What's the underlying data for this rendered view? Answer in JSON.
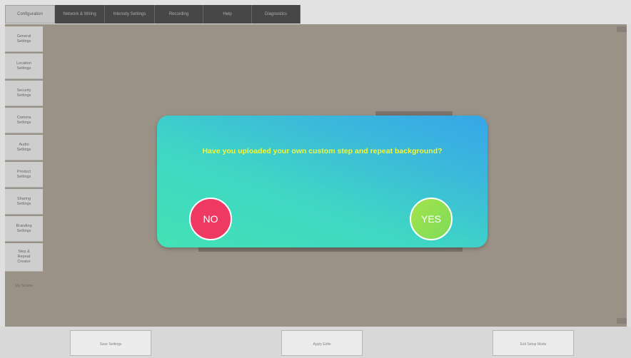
{
  "tabs": [
    {
      "label": "Configuration",
      "active": true
    },
    {
      "label": "Network & Wiring",
      "active": false
    },
    {
      "label": "Intensity Settings",
      "active": false
    },
    {
      "label": "Recording",
      "active": false
    },
    {
      "label": "Help",
      "active": false
    },
    {
      "label": "Diagnostics",
      "active": false
    }
  ],
  "sidebar": {
    "items": [
      {
        "label": "General\nSettings"
      },
      {
        "label": "Location\nSettings"
      },
      {
        "label": "Security\nSettings"
      },
      {
        "label": "Camera\nSettings"
      },
      {
        "label": "Audio\nSettings"
      },
      {
        "label": "Product\nSettings"
      },
      {
        "label": "Sharing\nSettings"
      },
      {
        "label": "Branding\nSettings"
      },
      {
        "label": "Step &\nRepeat\nCreator"
      },
      {
        "label": "My Scans"
      }
    ]
  },
  "bottom_buttons": [
    {
      "label": "Save Settings"
    },
    {
      "label": "Apply Edits"
    },
    {
      "label": "Exit Setup Mode"
    }
  ],
  "dialog": {
    "question": "Have you uploaded your own custom step and repeat background?",
    "no_label": "NO",
    "yes_label": "YES"
  },
  "colors": {
    "no_button": "#ee3a63",
    "yes_button": "#a3e34b",
    "question_text": "#f2f53a",
    "modal_gradient_start": "#43e2b5",
    "modal_gradient_end": "#36a6e8"
  }
}
